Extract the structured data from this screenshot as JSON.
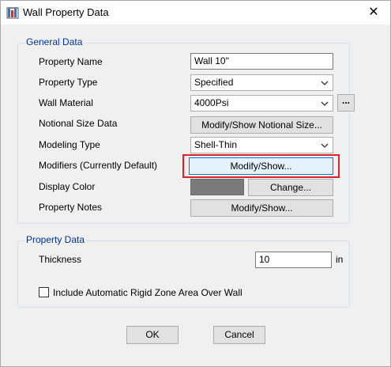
{
  "window": {
    "title": "Wall Property Data",
    "close_glyph": "✕"
  },
  "general": {
    "title": "General Data",
    "property_name": {
      "label": "Property Name",
      "value": "Wall 10\""
    },
    "property_type": {
      "label": "Property Type",
      "value": "Specified"
    },
    "wall_material": {
      "label": "Wall Material",
      "value": "4000Psi",
      "browse_label": "..."
    },
    "notional_size": {
      "label": "Notional Size Data",
      "button": "Modify/Show Notional Size..."
    },
    "modeling_type": {
      "label": "Modeling Type",
      "value": "Shell-Thin"
    },
    "modifiers": {
      "label": "Modifiers (Currently Default)",
      "button": "Modify/Show..."
    },
    "display_color": {
      "label": "Display Color",
      "color": "#7a7a7a",
      "button": "Change..."
    },
    "property_notes": {
      "label": "Property Notes",
      "button": "Modify/Show..."
    }
  },
  "property": {
    "title": "Property Data",
    "thickness": {
      "label": "Thickness",
      "value": "10",
      "unit": "in"
    },
    "rigid_zone": {
      "label": "Include Automatic Rigid Zone Area Over Wall",
      "checked": false
    }
  },
  "footer": {
    "ok": "OK",
    "cancel": "Cancel"
  },
  "colors": {
    "accent": "#003399",
    "highlight": "#e0202a",
    "focus": "#0078d7"
  }
}
